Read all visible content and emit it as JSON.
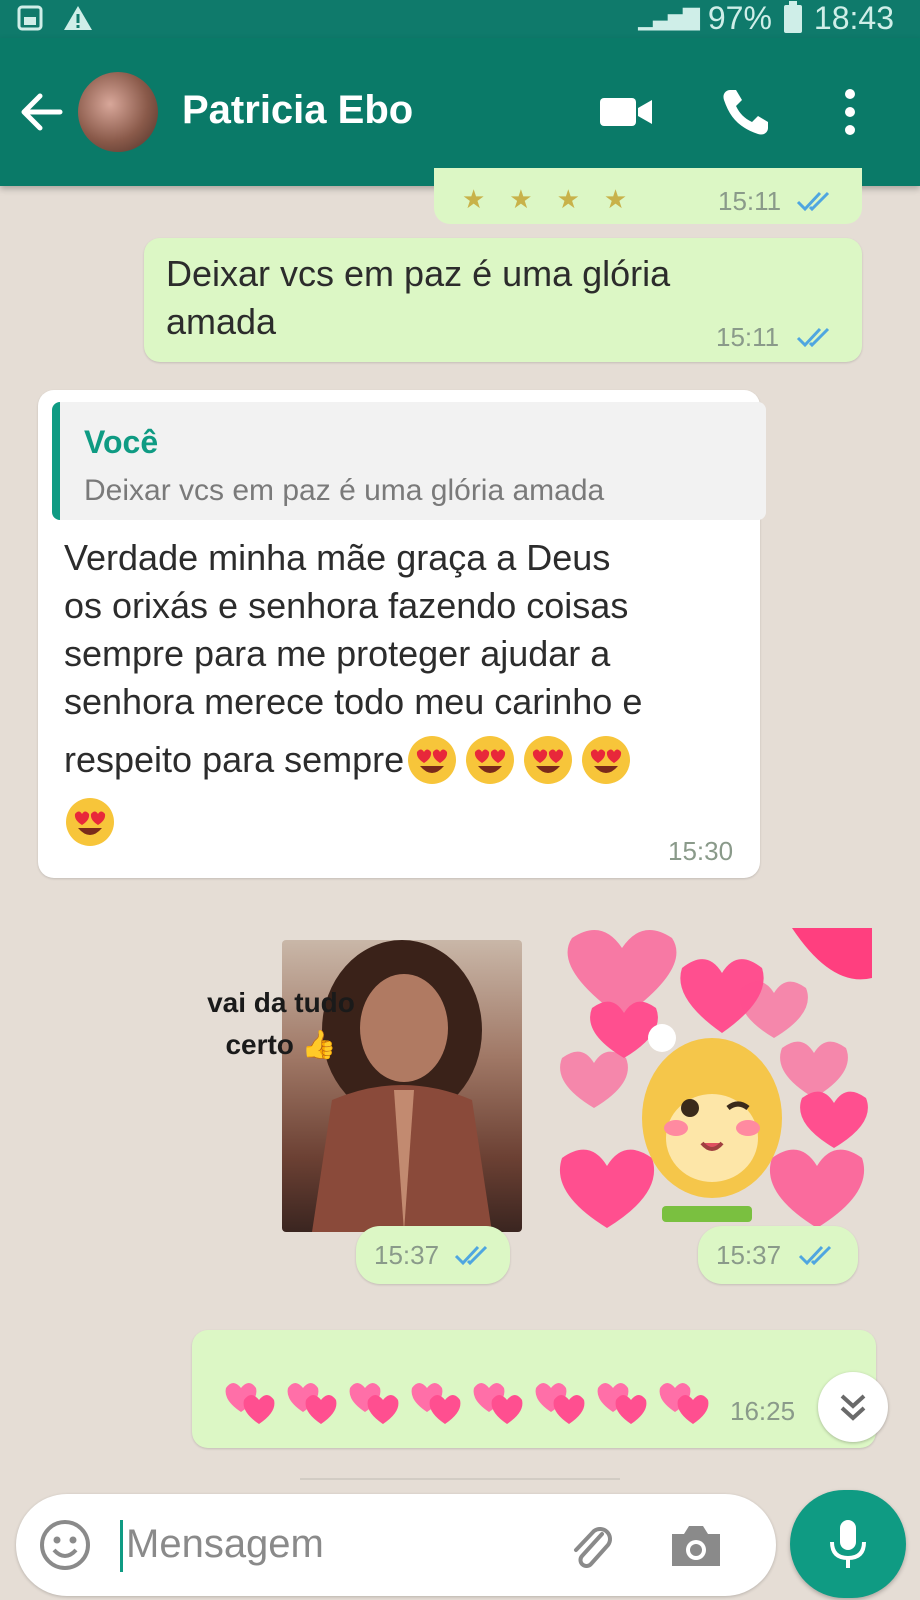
{
  "status_bar": {
    "battery": "97%",
    "time": "18:43"
  },
  "header": {
    "contact_name": "Patricia Ebo",
    "back_icon": "arrow-left-icon",
    "video_icon": "video-camera-icon",
    "call_icon": "phone-icon",
    "menu_icon": "more-vert-icon"
  },
  "messages": [
    {
      "direction": "out",
      "type": "stickers",
      "time": "15:11",
      "status": "read"
    },
    {
      "direction": "out",
      "type": "text",
      "text": "Deixar vcs em paz é uma glória amada",
      "line1": "Deixar vcs em paz é uma glória",
      "line2": "amada",
      "time": "15:11",
      "status": "read"
    },
    {
      "direction": "in",
      "type": "reply",
      "quote_author": "Você",
      "quote_text": "Deixar vcs em paz é uma glória amada",
      "lines": [
        "Verdade minha mãe graça a Deus",
        "os orixás e senhora fazendo coisas",
        "sempre para me proteger ajudar a",
        "senhora merece todo meu carinho e",
        "respeito para sempre"
      ],
      "emoji": "heart-eyes-emoji",
      "emoji_count": 5,
      "time": "15:30"
    },
    {
      "direction": "out",
      "type": "sticker",
      "caption_line1": "vai da tudo",
      "caption_line2": "certo",
      "time": "15:37",
      "status": "read"
    },
    {
      "direction": "out",
      "type": "sticker",
      "description_icon": "hearts-bunny-sticker",
      "time": "15:37",
      "status": "read"
    },
    {
      "direction": "out",
      "type": "emoji",
      "emoji": "two-hearts-emoji",
      "emoji_count": 8,
      "time": "16:25",
      "status": "read"
    }
  ],
  "input": {
    "placeholder": "Mensagem",
    "emoji_icon": "smiley-icon",
    "attach_icon": "paperclip-icon",
    "camera_icon": "camera-icon",
    "mic_icon": "microphone-icon"
  },
  "colors": {
    "header": "#0a7a68",
    "accent": "#0f9b83",
    "outgoing_bubble": "#dcf7c5",
    "chat_bg": "#e5ddd5"
  }
}
